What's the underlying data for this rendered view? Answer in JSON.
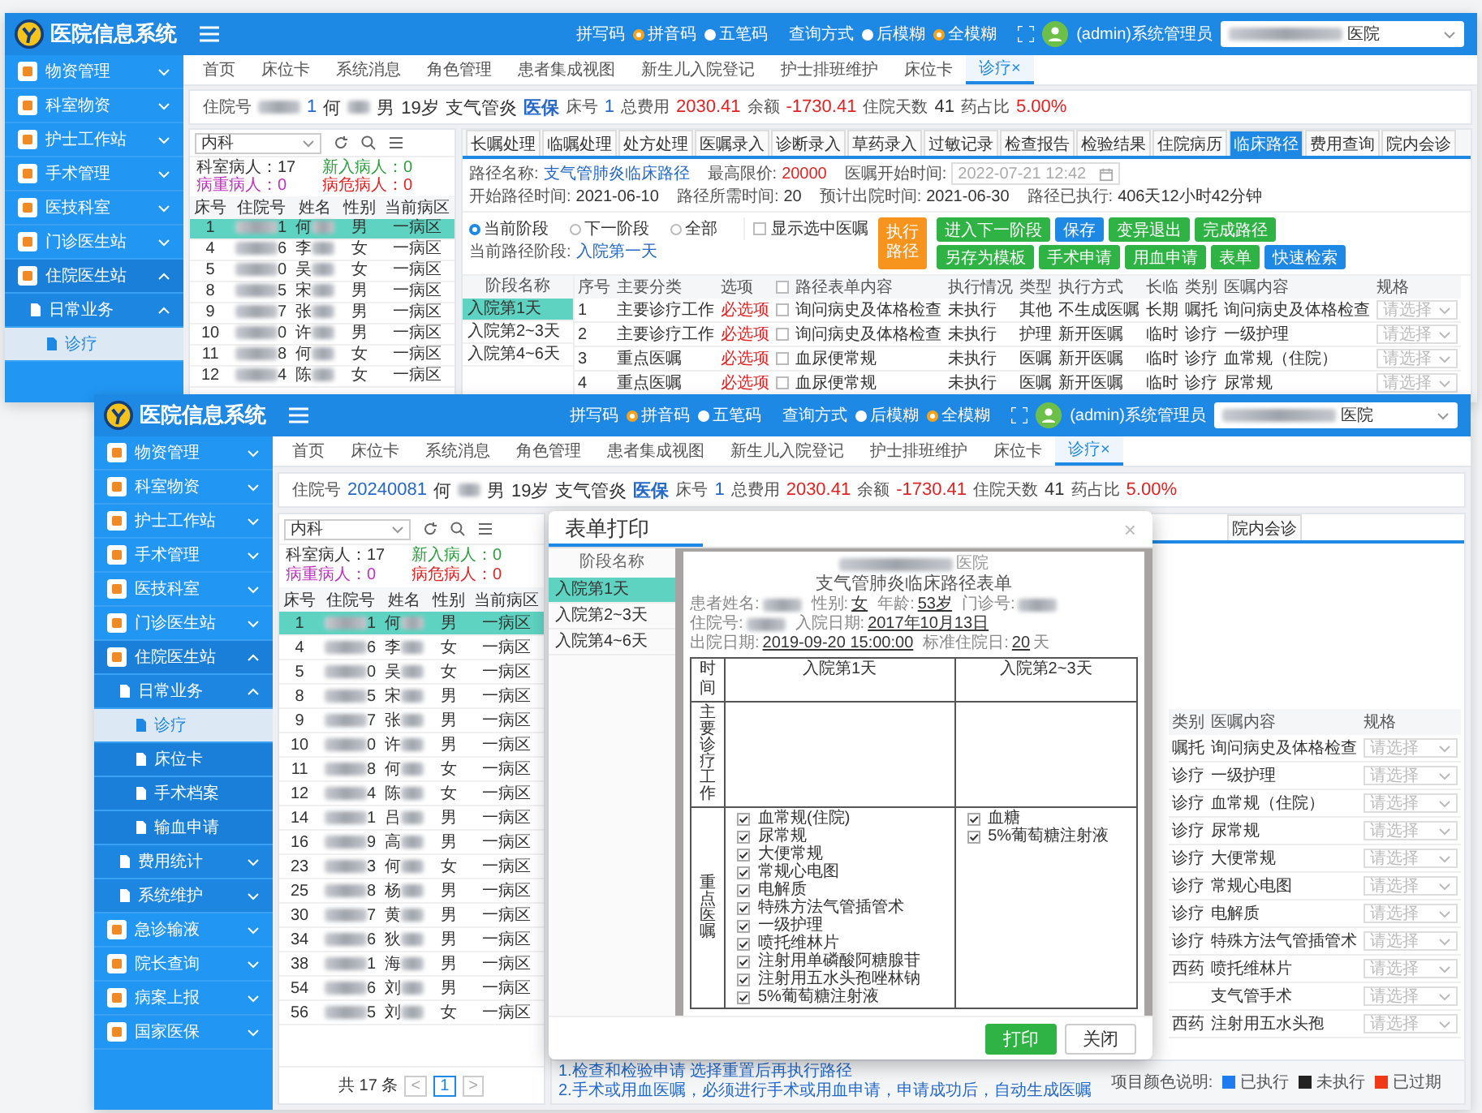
{
  "windows": [
    {
      "kind": "back",
      "header": {
        "app_title": "医院信息系统",
        "spell_label": "拼写码",
        "spell_options": [
          {
            "label": "拼音码",
            "selected": true
          },
          {
            "label": "五笔码",
            "selected": false
          }
        ],
        "query_label": "查询方式",
        "query_options": [
          {
            "label": "后模糊",
            "selected": false
          },
          {
            "label": "全模糊",
            "selected": true
          }
        ],
        "user": "(admin)系统管理员",
        "hospital_suffix": "医院"
      },
      "sidebar": [
        {
          "label": "物资管理",
          "expanded": false
        },
        {
          "label": "科室物资",
          "expanded": false
        },
        {
          "label": "护士工作站",
          "expanded": false
        },
        {
          "label": "手术管理",
          "expanded": false
        },
        {
          "label": "医技科室",
          "expanded": false
        },
        {
          "label": "门诊医生站",
          "expanded": false
        },
        {
          "label": "住院医生站",
          "expanded": true,
          "children": [
            {
              "label": "日常业务",
              "expanded": true,
              "children": [
                {
                  "label": "诊疗",
                  "selected": true
                }
              ]
            }
          ]
        }
      ],
      "tabs": [
        {
          "label": "首页",
          "selected": false
        },
        {
          "label": "床位卡",
          "selected": false
        },
        {
          "label": "系统消息",
          "selected": false
        },
        {
          "label": "角色管理",
          "selected": false
        },
        {
          "label": "患者集成视图",
          "selected": false
        },
        {
          "label": "新生儿入院登记",
          "selected": false
        },
        {
          "label": "护士排班维护",
          "selected": false
        },
        {
          "label": "床位卡",
          "selected": false
        },
        {
          "label": "诊疗",
          "selected": true,
          "close_mark": "×"
        }
      ],
      "patient": {
        "id_label": "住院号",
        "id": "1",
        "id_blurred": true,
        "surname": "何",
        "sex": "男",
        "age": "19岁",
        "diagnosis": "支气管炎",
        "insurance": "医保",
        "bed_label": "床号",
        "bed": "1",
        "total_label": "总费用",
        "total": "2030.41",
        "balance_label": "余额",
        "balance": "-1730.41",
        "days_label": "住院天数",
        "days": "41",
        "drug_label": "药占比",
        "drug": "5.00%"
      },
      "left_panel": {
        "department": "内科",
        "stats": [
          {
            "text": "科室病人：17",
            "color": "#333333"
          },
          {
            "text": "新入病人：0",
            "color": "#2e9e3e"
          },
          {
            "text": "病重病人：0",
            "color": "#c02fc0"
          },
          {
            "text": "病危病人：0",
            "color": "#e02424"
          }
        ],
        "columns": [
          "床号",
          "住院号",
          "姓名",
          "性别",
          "当前病区"
        ],
        "rows": [
          {
            "bed": "1",
            "id_tail": "1",
            "surname": "何",
            "sex": "男",
            "ward": "一病区",
            "selected": true
          },
          {
            "bed": "4",
            "id_tail": "6",
            "surname": "李",
            "sex": "女",
            "ward": "一病区",
            "selected": false
          },
          {
            "bed": "5",
            "id_tail": "0",
            "surname": "吴",
            "sex": "女",
            "ward": "一病区",
            "selected": false
          },
          {
            "bed": "8",
            "id_tail": "5",
            "surname": "宋",
            "sex": "男",
            "ward": "一病区",
            "selected": false
          },
          {
            "bed": "9",
            "id_tail": "7",
            "surname": "张",
            "sex": "男",
            "ward": "一病区",
            "selected": false
          },
          {
            "bed": "10",
            "id_tail": "0",
            "surname": "许",
            "sex": "男",
            "ward": "一病区",
            "selected": false
          },
          {
            "bed": "11",
            "id_tail": "8",
            "surname": "何",
            "sex": "女",
            "ward": "一病区",
            "selected": false
          },
          {
            "bed": "12",
            "id_tail": "4",
            "surname": "陈",
            "sex": "女",
            "ward": "一病区",
            "selected": false
          }
        ]
      },
      "work_tabs": [
        {
          "label": "长嘱处理",
          "selected": false
        },
        {
          "label": "临嘱处理",
          "selected": false
        },
        {
          "label": "处方处理",
          "selected": false
        },
        {
          "label": "医嘱录入",
          "selected": false
        },
        {
          "label": "诊断录入",
          "selected": false
        },
        {
          "label": "草药录入",
          "selected": false
        },
        {
          "label": "过敏记录",
          "selected": false
        },
        {
          "label": "检查报告",
          "selected": false
        },
        {
          "label": "检验结果",
          "selected": false
        },
        {
          "label": "住院病历",
          "selected": false
        },
        {
          "label": "临床路径",
          "selected": true
        },
        {
          "label": "费用查询",
          "selected": false
        },
        {
          "label": "院内会诊",
          "selected": false
        }
      ],
      "path_info": {
        "name_label": "路径名称:",
        "name": "支气管肺炎临床路径",
        "limit_label": "最高限价:",
        "limit": "20000",
        "start_label": "医嘱开始时间:",
        "start_value": "2022-07-21 12:42",
        "facts": [
          {
            "label": "开始路径时间:",
            "value": "2021-06-10"
          },
          {
            "label": "路径所需时间:",
            "value": "20"
          },
          {
            "label": "预计出院时间:",
            "value": "2021-06-30"
          },
          {
            "label": "路径已执行:",
            "value": "406天12小时42分钟"
          }
        ]
      },
      "stage_controls": {
        "radios": [
          {
            "label": "当前阶段",
            "selected": true
          },
          {
            "label": "下一阶段",
            "selected": false
          },
          {
            "label": "全部",
            "selected": false
          }
        ],
        "current_label": "当前路径阶段:",
        "current_stage": "入院第一天",
        "show_selected": {
          "label": "显示选中医嘱",
          "checked": false
        },
        "main_button": {
          "label": "执行路径",
          "color": "#f7941d"
        },
        "button_rows": [
          [
            {
              "label": "进入下一阶段",
              "color": "#2fb344"
            },
            {
              "label": "保存",
              "color": "#1e88e5"
            },
            {
              "label": "变异退出",
              "color": "#2fb344"
            },
            {
              "label": "完成路径",
              "color": "#2fb344"
            }
          ],
          [
            {
              "label": "另存为模板",
              "color": "#2fb344"
            },
            {
              "label": "手术申请",
              "color": "#2fb344"
            },
            {
              "label": "用血申请",
              "color": "#2fb344"
            },
            {
              "label": "表单",
              "color": "#2fb344"
            },
            {
              "label": "快速检索",
              "color": "#1e88e5"
            }
          ]
        ]
      },
      "stage_list": {
        "header": "阶段名称",
        "items": [
          {
            "label": "入院第1天",
            "selected": true
          },
          {
            "label": "入院第2~3天",
            "selected": false
          },
          {
            "label": "入院第4~6天",
            "selected": false
          }
        ]
      },
      "path_table": {
        "all_checked": false,
        "columns": [
          "序号",
          "主要分类",
          "选项",
          "路径表单内容",
          "执行情况",
          "类型",
          "执行方式",
          "长临",
          "类别",
          "医嘱内容",
          "规格"
        ],
        "rows": [
          {
            "no": "1",
            "category": "主要诊疗工作",
            "option": "必选项",
            "checked": false,
            "content": "询问病史及体格检查",
            "status": "未执行",
            "type": "其他",
            "mode": "不生成医嘱",
            "term": "长期",
            "class": "嘱托",
            "order": "询问病史及体格检查",
            "spec": "请选择"
          },
          {
            "no": "2",
            "category": "主要诊疗工作",
            "option": "必选项",
            "checked": false,
            "content": "询问病史及体格检查",
            "status": "未执行",
            "type": "护理",
            "mode": "新开医嘱",
            "term": "临时",
            "class": "诊疗",
            "order": "一级护理",
            "spec": "请选择"
          },
          {
            "no": "3",
            "category": "重点医嘱",
            "option": "必选项",
            "checked": false,
            "content": "血尿便常规",
            "status": "未执行",
            "type": "医嘱",
            "mode": "新开医嘱",
            "term": "临时",
            "class": "诊疗",
            "order": "血常规（住院）",
            "spec": "请选择"
          },
          {
            "no": "4",
            "category": "重点医嘱",
            "option": "必选项",
            "checked": false,
            "content": "血尿便常规",
            "status": "未执行",
            "type": "医嘱",
            "mode": "新开医嘱",
            "term": "临时",
            "class": "诊疗",
            "order": "尿常规",
            "spec": "请选择"
          }
        ]
      }
    },
    {
      "kind": "front",
      "header": {
        "app_title": "医院信息系统",
        "spell_label": "拼写码",
        "spell_options": [
          {
            "label": "拼音码",
            "selected": true
          },
          {
            "label": "五笔码",
            "selected": false
          }
        ],
        "query_label": "查询方式",
        "query_options": [
          {
            "label": "后模糊",
            "selected": false
          },
          {
            "label": "全模糊",
            "selected": true
          }
        ],
        "user": "(admin)系统管理员",
        "hospital_suffix": "医院"
      },
      "sidebar": [
        {
          "label": "物资管理",
          "expanded": false
        },
        {
          "label": "科室物资",
          "expanded": false
        },
        {
          "label": "护士工作站",
          "expanded": false
        },
        {
          "label": "手术管理",
          "expanded": false
        },
        {
          "label": "医技科室",
          "expanded": false
        },
        {
          "label": "门诊医生站",
          "expanded": false
        },
        {
          "label": "住院医生站",
          "expanded": true,
          "children": [
            {
              "label": "日常业务",
              "expanded": true,
              "children": [
                {
                  "label": "诊疗",
                  "selected": true
                },
                {
                  "label": "床位卡",
                  "selected": false
                },
                {
                  "label": "手术档案",
                  "selected": false
                },
                {
                  "label": "输血申请",
                  "selected": false
                }
              ]
            },
            {
              "label": "费用统计",
              "expanded": false
            },
            {
              "label": "系统维护",
              "expanded": false
            }
          ]
        },
        {
          "label": "急诊输液",
          "expanded": false
        },
        {
          "label": "院长查询",
          "expanded": false
        },
        {
          "label": "病案上报",
          "expanded": false
        },
        {
          "label": "国家医保",
          "expanded": false
        }
      ],
      "tabs": [
        {
          "label": "首页",
          "selected": false
        },
        {
          "label": "床位卡",
          "selected": false
        },
        {
          "label": "系统消息",
          "selected": false
        },
        {
          "label": "角色管理",
          "selected": false
        },
        {
          "label": "患者集成视图",
          "selected": false
        },
        {
          "label": "新生儿入院登记",
          "selected": false
        },
        {
          "label": "护士排班维护",
          "selected": false
        },
        {
          "label": "床位卡",
          "selected": false
        },
        {
          "label": "诊疗",
          "selected": true,
          "close_mark": "×"
        }
      ],
      "patient": {
        "id_label": "住院号",
        "id": "20240081",
        "id_blurred": false,
        "surname": "何",
        "sex": "男",
        "age": "19岁",
        "diagnosis": "支气管炎",
        "insurance": "医保",
        "bed_label": "床号",
        "bed": "1",
        "total_label": "总费用",
        "total": "2030.41",
        "balance_label": "余额",
        "balance": "-1730.41",
        "days_label": "住院天数",
        "days": "41",
        "drug_label": "药占比",
        "drug": "5.00%"
      },
      "left_panel": {
        "department": "内科",
        "stats": [
          {
            "text": "科室病人：17",
            "color": "#333333"
          },
          {
            "text": "新入病人：0",
            "color": "#2e9e3e"
          },
          {
            "text": "病重病人：0",
            "color": "#c02fc0"
          },
          {
            "text": "病危病人：0",
            "color": "#e02424"
          }
        ],
        "columns": [
          "床号",
          "住院号",
          "姓名",
          "性别",
          "当前病区"
        ],
        "rows": [
          {
            "bed": "1",
            "id_tail": "1",
            "surname": "何",
            "sex": "男",
            "ward": "一病区",
            "selected": true
          },
          {
            "bed": "4",
            "id_tail": "6",
            "surname": "李",
            "sex": "女",
            "ward": "一病区",
            "selected": false
          },
          {
            "bed": "5",
            "id_tail": "0",
            "surname": "吴",
            "sex": "女",
            "ward": "一病区",
            "selected": false
          },
          {
            "bed": "8",
            "id_tail": "5",
            "surname": "宋",
            "sex": "男",
            "ward": "一病区",
            "selected": false
          },
          {
            "bed": "9",
            "id_tail": "7",
            "surname": "张",
            "sex": "男",
            "ward": "一病区",
            "selected": false
          },
          {
            "bed": "10",
            "id_tail": "0",
            "surname": "许",
            "sex": "男",
            "ward": "一病区",
            "selected": false
          },
          {
            "bed": "11",
            "id_tail": "8",
            "surname": "何",
            "sex": "女",
            "ward": "一病区",
            "selected": false
          },
          {
            "bed": "12",
            "id_tail": "4",
            "surname": "陈",
            "sex": "女",
            "ward": "一病区",
            "selected": false
          },
          {
            "bed": "14",
            "id_tail": "1",
            "surname": "吕",
            "sex": "男",
            "ward": "一病区",
            "selected": false
          },
          {
            "bed": "16",
            "id_tail": "9",
            "surname": "高",
            "sex": "男",
            "ward": "一病区",
            "selected": false
          },
          {
            "bed": "23",
            "id_tail": "3",
            "surname": "何",
            "sex": "女",
            "ward": "一病区",
            "selected": false
          },
          {
            "bed": "25",
            "id_tail": "8",
            "surname": "杨",
            "sex": "男",
            "ward": "一病区",
            "selected": false
          },
          {
            "bed": "30",
            "id_tail": "7",
            "surname": "黄",
            "sex": "男",
            "ward": "一病区",
            "selected": false
          },
          {
            "bed": "34",
            "id_tail": "6",
            "surname": "狄",
            "sex": "男",
            "ward": "一病区",
            "selected": false
          },
          {
            "bed": "38",
            "id_tail": "1",
            "surname": "海",
            "sex": "男",
            "ward": "一病区",
            "selected": false
          },
          {
            "bed": "54",
            "id_tail": "6",
            "surname": "刘",
            "sex": "男",
            "ward": "一病区",
            "selected": false
          },
          {
            "bed": "56",
            "id_tail": "5",
            "surname": "刘",
            "sex": "女",
            "ward": "一病区",
            "selected": false
          }
        ],
        "pagination": {
          "total": "共 17 条",
          "prev": "<",
          "pages": [
            {
              "label": "1",
              "selected": true
            }
          ],
          "next": ">"
        }
      },
      "work_tabs": [
        {
          "label": "院内会诊",
          "selected": false
        }
      ],
      "order_table": {
        "columns": [
          "类别",
          "医嘱内容",
          "规格"
        ],
        "rows": [
          {
            "class": "嘱托",
            "order": "询问病史及体格检查",
            "spec": "请选择"
          },
          {
            "class": "诊疗",
            "order": "一级护理",
            "spec": "请选择"
          },
          {
            "class": "诊疗",
            "order": "血常规（住院）",
            "spec": "请选择"
          },
          {
            "class": "诊疗",
            "order": "尿常规",
            "spec": "请选择"
          },
          {
            "class": "诊疗",
            "order": "大便常规",
            "spec": "请选择"
          },
          {
            "class": "诊疗",
            "order": "常规心电图",
            "spec": "请选择"
          },
          {
            "class": "诊疗",
            "order": "电解质",
            "spec": "请选择"
          },
          {
            "class": "诊疗",
            "order": "特殊方法气管插管术",
            "spec": "请选择"
          },
          {
            "class": "西药",
            "order": "喷托维林片",
            "spec": "请选择"
          },
          {
            "order": "支气管手术",
            "spec": "请选择"
          },
          {
            "class": "西药",
            "order": "注射用五水头孢",
            "spec": "请选择"
          }
        ]
      },
      "notes": [
        "1.检查和检验申请 选择重置后再执行路径",
        "2.手术或用血医嘱，必须进行手术或用血申请，申请成功后，自动生成医嘱"
      ],
      "legend": {
        "label": "项目颜色说明:",
        "items": [
          {
            "label": "已执行",
            "color": "#1e7cf0"
          },
          {
            "label": "未执行",
            "color": "#222222"
          },
          {
            "label": "已过期",
            "color": "#f03a17"
          }
        ]
      },
      "modal": {
        "title": "表单打印",
        "close": "×",
        "list_header": "阶段名称",
        "stages": [
          {
            "label": "入院第1天",
            "selected": true
          },
          {
            "label": "入院第2~3天",
            "selected": false
          },
          {
            "label": "入院第4~6天",
            "selected": false
          }
        ],
        "document": {
          "hospital_suffix": "医院",
          "title": "支气管肺炎临床路径表单",
          "fields": [
            {
              "label": "患者姓名:"
            },
            {
              "label": "性别:",
              "value": "女"
            },
            {
              "label": "年龄:",
              "value": "53岁"
            },
            {
              "label": "门诊号:"
            },
            {
              "label": "住院号:"
            },
            {
              "label": "入院日期:",
              "value": "2017年10月13日"
            },
            {
              "label": "出院日期:",
              "value": "2019-09-20 15:00:00"
            },
            {
              "label": "标准住院日:",
              "value": "20",
              "unit": "天"
            }
          ],
          "time_header": "时间",
          "day_headers": [
            "入院第1天",
            "入院第2~3天"
          ],
          "sections": [
            {
              "label": "主要诊疗工作"
            },
            {
              "label": "重点医嘱",
              "days": [
                [
                  {
                    "text": "血常规(住院)",
                    "checked": true
                  },
                  {
                    "text": "尿常规",
                    "checked": true
                  },
                  {
                    "text": "大便常规",
                    "checked": true
                  },
                  {
                    "text": "常规心电图",
                    "checked": true
                  },
                  {
                    "text": "电解质",
                    "checked": true
                  },
                  {
                    "text": "特殊方法气管插管术",
                    "checked": true
                  },
                  {
                    "text": "一级护理",
                    "checked": true
                  },
                  {
                    "text": "喷托维林片",
                    "checked": true
                  },
                  {
                    "text": "注射用单磷酸阿糖腺苷",
                    "checked": true
                  },
                  {
                    "text": "注射用五水头孢唑林钠",
                    "checked": true
                  },
                  {
                    "text": "5%葡萄糖注射液",
                    "checked": true
                  }
                ],
                [
                  {
                    "text": "血糖",
                    "checked": true
                  },
                  {
                    "text": "5%葡萄糖注射液",
                    "checked": true
                  }
                ]
              ]
            }
          ]
        },
        "buttons": [
          {
            "label": "打印",
            "kind": "primary"
          },
          {
            "label": "关闭",
            "kind": "default"
          }
        ]
      }
    }
  ]
}
